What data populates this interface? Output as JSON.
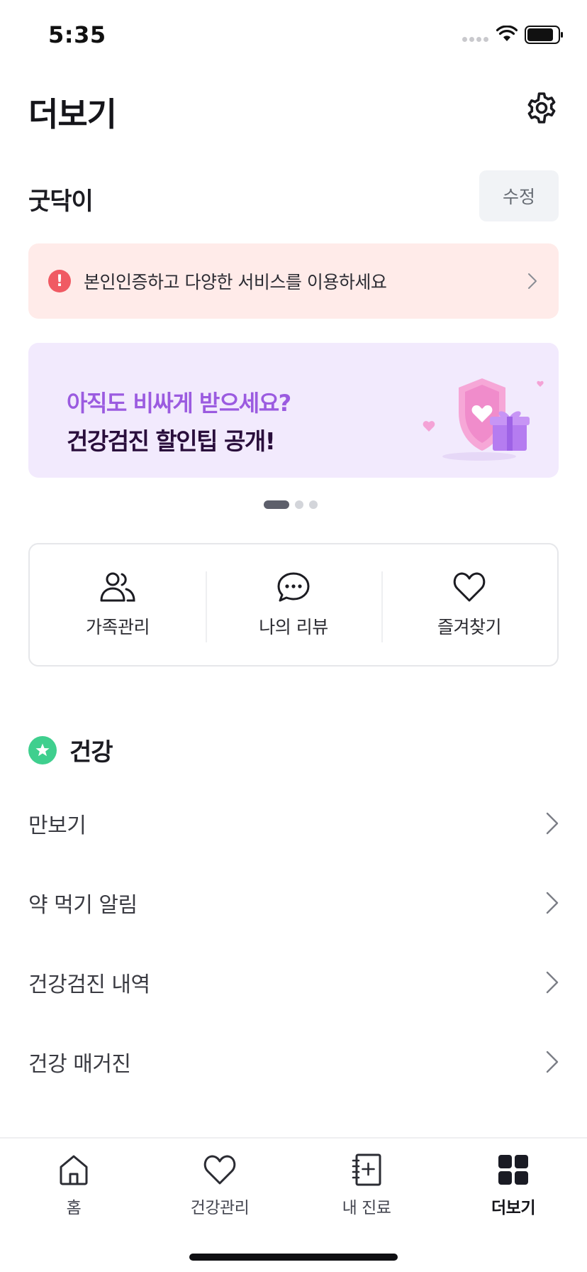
{
  "status_bar": {
    "time": "5:35"
  },
  "header": {
    "title": "더보기",
    "settings_icon": "gear-icon"
  },
  "profile": {
    "name": "굿닥이",
    "edit_label": "수정"
  },
  "verify_banner": {
    "icon": "exclamation-icon",
    "text": "본인인증하고 다양한 서비스를 이용하세요",
    "color": "#ffebe9"
  },
  "promo": {
    "subtitle": "아직도 비싸게 받으세요?",
    "title": "건강검진 할인팁 공개!",
    "background": "#f2eafd",
    "page_current": 1,
    "page_total": 3
  },
  "quick_menu": [
    {
      "label": "가족관리",
      "icon": "family-icon"
    },
    {
      "label": "나의 리뷰",
      "icon": "chat-bubble-icon"
    },
    {
      "label": "즐겨찾기",
      "icon": "heart-icon"
    }
  ],
  "section": {
    "title": "건강",
    "icon": "star-icon",
    "accent": "#3fcf8e"
  },
  "menu_items": [
    {
      "label": "만보기"
    },
    {
      "label": "약 먹기 알림"
    },
    {
      "label": "건강검진 내역"
    },
    {
      "label": "건강 매거진"
    }
  ],
  "tab_bar": [
    {
      "label": "홈",
      "icon": "home-icon"
    },
    {
      "label": "건강관리",
      "icon": "heart-icon"
    },
    {
      "label": "내 진료",
      "icon": "notebook-plus-icon"
    },
    {
      "label": "더보기",
      "icon": "grid-icon",
      "active": true
    }
  ]
}
